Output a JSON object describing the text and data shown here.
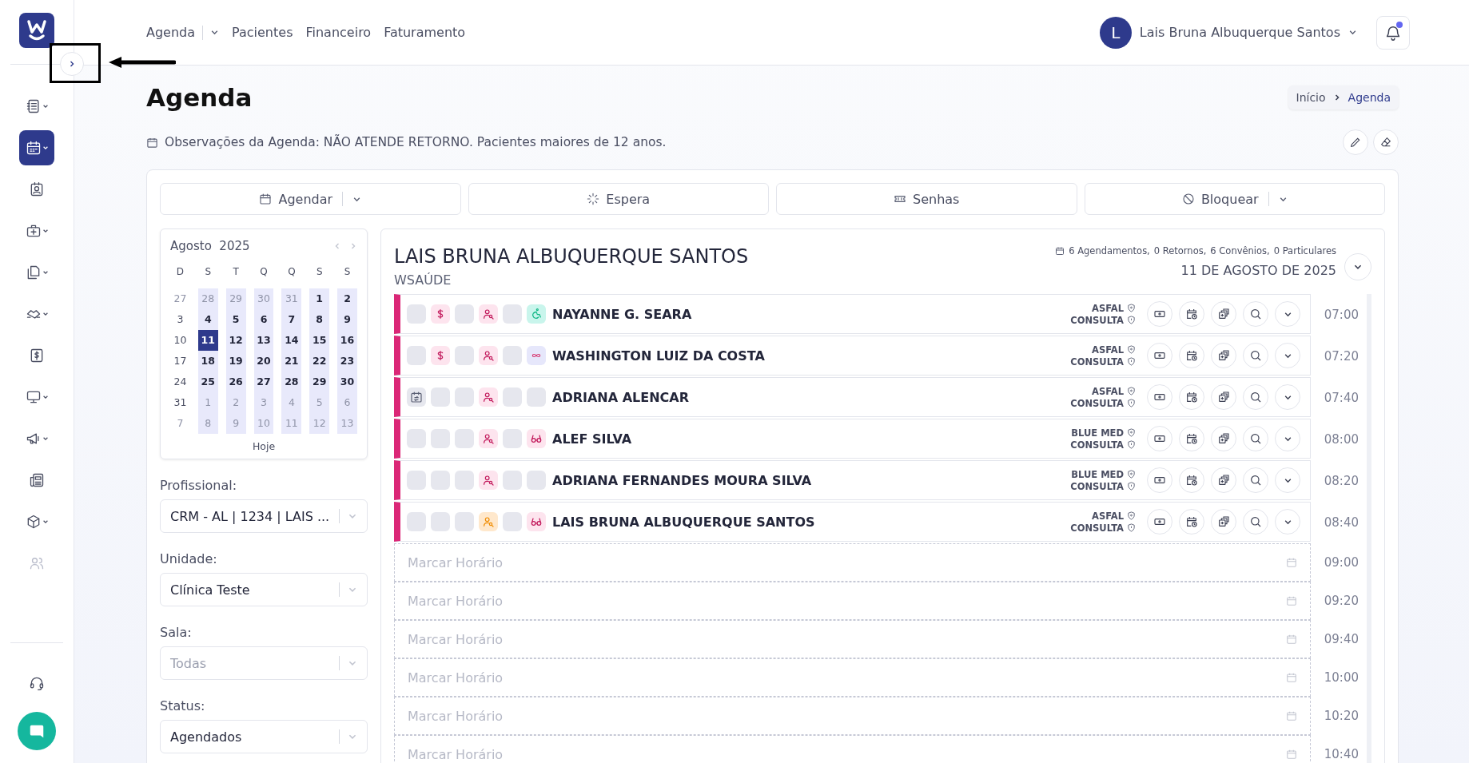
{
  "sidebar": {
    "items": [
      {
        "kind": "list",
        "dropdown": true,
        "selected": false,
        "disabled": false
      },
      {
        "kind": "calendar",
        "dropdown": true,
        "selected": true,
        "disabled": false
      },
      {
        "kind": "contact",
        "dropdown": false,
        "selected": false,
        "disabled": false
      },
      {
        "kind": "medkit",
        "dropdown": true,
        "selected": false,
        "disabled": false
      },
      {
        "kind": "files",
        "dropdown": true,
        "selected": false,
        "disabled": false
      },
      {
        "kind": "handshake",
        "dropdown": true,
        "selected": false,
        "disabled": false
      },
      {
        "kind": "money",
        "dropdown": false,
        "selected": false,
        "disabled": false
      },
      {
        "kind": "monitor",
        "dropdown": true,
        "selected": false,
        "disabled": false
      },
      {
        "kind": "megaphone",
        "dropdown": true,
        "selected": false,
        "disabled": false
      },
      {
        "kind": "news",
        "dropdown": false,
        "selected": false,
        "disabled": false
      },
      {
        "kind": "cube",
        "dropdown": true,
        "selected": false,
        "disabled": false
      },
      {
        "kind": "users",
        "dropdown": false,
        "selected": false,
        "disabled": true
      }
    ]
  },
  "nav": [
    {
      "label": "Agenda",
      "dropdown": true
    },
    {
      "label": "Pacientes",
      "dropdown": false
    },
    {
      "label": "Financeiro",
      "dropdown": false
    },
    {
      "label": "Faturamento",
      "dropdown": false
    }
  ],
  "user": {
    "initial": "L",
    "name": "Lais Bruna Albuquerque Santos",
    "unread": true
  },
  "page_title": "Agenda",
  "breadcrumb": [
    {
      "label": "Início",
      "current": false
    },
    {
      "label": "Agenda",
      "current": true
    }
  ],
  "observation": "Observações da Agenda: NÃO ATENDE RETORNO. Pacientes maiores de 12 anos.",
  "actions": [
    {
      "label": "Agendar",
      "kind": "calendar",
      "dropdown": true
    },
    {
      "label": "Espera",
      "kind": "loader",
      "dropdown": false
    },
    {
      "label": "Senhas",
      "kind": "ticket",
      "dropdown": false
    },
    {
      "label": "Bloquear",
      "kind": "ban",
      "dropdown": true
    }
  ],
  "calendar": {
    "month": "Agosto",
    "year": "2025",
    "weekdays": [
      "D",
      "S",
      "T",
      "Q",
      "Q",
      "S",
      "S"
    ],
    "today_label": "Hoje",
    "weeks": [
      [
        {
          "d": "27",
          "outside": true,
          "open": false,
          "selected": false
        },
        {
          "d": "28",
          "outside": true,
          "open": true,
          "selected": false
        },
        {
          "d": "29",
          "outside": true,
          "open": true,
          "selected": false
        },
        {
          "d": "30",
          "outside": true,
          "open": true,
          "selected": false
        },
        {
          "d": "31",
          "outside": true,
          "open": true,
          "selected": false
        },
        {
          "d": "1",
          "outside": false,
          "open": true,
          "selected": false
        },
        {
          "d": "2",
          "outside": false,
          "open": true,
          "selected": false
        }
      ],
      [
        {
          "d": "3",
          "outside": false,
          "open": false,
          "selected": false
        },
        {
          "d": "4",
          "outside": false,
          "open": true,
          "selected": false
        },
        {
          "d": "5",
          "outside": false,
          "open": true,
          "selected": false
        },
        {
          "d": "6",
          "outside": false,
          "open": true,
          "selected": false
        },
        {
          "d": "7",
          "outside": false,
          "open": true,
          "selected": false
        },
        {
          "d": "8",
          "outside": false,
          "open": true,
          "selected": false
        },
        {
          "d": "9",
          "outside": false,
          "open": true,
          "selected": false
        }
      ],
      [
        {
          "d": "10",
          "outside": false,
          "open": false,
          "selected": false
        },
        {
          "d": "11",
          "outside": false,
          "open": true,
          "selected": true
        },
        {
          "d": "12",
          "outside": false,
          "open": true,
          "selected": false
        },
        {
          "d": "13",
          "outside": false,
          "open": true,
          "selected": false
        },
        {
          "d": "14",
          "outside": false,
          "open": true,
          "selected": false
        },
        {
          "d": "15",
          "outside": false,
          "open": true,
          "selected": false
        },
        {
          "d": "16",
          "outside": false,
          "open": true,
          "selected": false
        }
      ],
      [
        {
          "d": "17",
          "outside": false,
          "open": false,
          "selected": false
        },
        {
          "d": "18",
          "outside": false,
          "open": true,
          "selected": false
        },
        {
          "d": "19",
          "outside": false,
          "open": true,
          "selected": false
        },
        {
          "d": "20",
          "outside": false,
          "open": true,
          "selected": false
        },
        {
          "d": "21",
          "outside": false,
          "open": true,
          "selected": false
        },
        {
          "d": "22",
          "outside": false,
          "open": true,
          "selected": false
        },
        {
          "d": "23",
          "outside": false,
          "open": true,
          "selected": false
        }
      ],
      [
        {
          "d": "24",
          "outside": false,
          "open": false,
          "selected": false
        },
        {
          "d": "25",
          "outside": false,
          "open": true,
          "selected": false
        },
        {
          "d": "26",
          "outside": false,
          "open": true,
          "selected": false
        },
        {
          "d": "27",
          "outside": false,
          "open": true,
          "selected": false
        },
        {
          "d": "28",
          "outside": false,
          "open": true,
          "selected": false
        },
        {
          "d": "29",
          "outside": false,
          "open": true,
          "selected": false
        },
        {
          "d": "30",
          "outside": false,
          "open": true,
          "selected": false
        }
      ],
      [
        {
          "d": "31",
          "outside": false,
          "open": false,
          "selected": false
        },
        {
          "d": "1",
          "outside": true,
          "open": true,
          "selected": false
        },
        {
          "d": "2",
          "outside": true,
          "open": true,
          "selected": false
        },
        {
          "d": "3",
          "outside": true,
          "open": true,
          "selected": false
        },
        {
          "d": "4",
          "outside": true,
          "open": true,
          "selected": false
        },
        {
          "d": "5",
          "outside": true,
          "open": true,
          "selected": false
        },
        {
          "d": "6",
          "outside": true,
          "open": true,
          "selected": false
        }
      ],
      [
        {
          "d": "7",
          "outside": true,
          "open": false,
          "selected": false
        },
        {
          "d": "8",
          "outside": true,
          "open": true,
          "selected": false
        },
        {
          "d": "9",
          "outside": true,
          "open": true,
          "selected": false
        },
        {
          "d": "10",
          "outside": true,
          "open": true,
          "selected": false
        },
        {
          "d": "11",
          "outside": true,
          "open": true,
          "selected": false
        },
        {
          "d": "12",
          "outside": true,
          "open": true,
          "selected": false
        },
        {
          "d": "13",
          "outside": true,
          "open": true,
          "selected": false
        }
      ]
    ]
  },
  "filters": [
    {
      "label": "Profissional:",
      "value": "CRM - AL | 1234 | LAIS ..."
    },
    {
      "label": "Unidade:",
      "value": "Clínica Teste"
    },
    {
      "label": "Sala:",
      "placeholder": "Todas"
    },
    {
      "label": "Status:",
      "value": "Agendados"
    }
  ],
  "schedule": {
    "professional": "LAIS BRUNA ALBUQUERQUE SANTOS",
    "unit": "WSAÚDE",
    "stats": [
      "6 Agendamentos,",
      "0 Retornos,",
      "6 Convênios,",
      "0 Particulares"
    ],
    "date": "11 DE AGOSTO DE 2025",
    "appointments": [
      {
        "name": "NAYANNE G. SEARA",
        "plan": "ASFAL",
        "type": "CONSULTA",
        "time": "07:00",
        "badges": [
          {
            "kind": "blank"
          },
          {
            "kind": "money"
          },
          {
            "kind": "blank"
          },
          {
            "kind": "patient"
          },
          {
            "kind": "blank"
          },
          {
            "kind": "accessibility"
          }
        ]
      },
      {
        "name": "WASHINGTON LUIZ DA COSTA",
        "plan": "ASFAL",
        "type": "CONSULTA",
        "time": "07:20",
        "badges": [
          {
            "kind": "blank"
          },
          {
            "kind": "money"
          },
          {
            "kind": "blank"
          },
          {
            "kind": "patient"
          },
          {
            "kind": "blank"
          },
          {
            "kind": "infinity"
          }
        ]
      },
      {
        "name": "ADRIANA ALENCAR",
        "plan": "ASFAL",
        "type": "CONSULTA",
        "time": "07:40",
        "badges": [
          {
            "kind": "reschedule"
          },
          {
            "kind": "blank"
          },
          {
            "kind": "blank"
          },
          {
            "kind": "patient"
          },
          {
            "kind": "blank"
          },
          {
            "kind": "blank"
          }
        ]
      },
      {
        "name": "ALEF SILVA",
        "plan": "BLUE MED",
        "type": "CONSULTA",
        "time": "08:00",
        "badges": [
          {
            "kind": "blank"
          },
          {
            "kind": "blank"
          },
          {
            "kind": "blank"
          },
          {
            "kind": "patient"
          },
          {
            "kind": "blank"
          },
          {
            "kind": "glasses"
          }
        ]
      },
      {
        "name": "ADRIANA FERNANDES MOURA SILVA",
        "plan": "BLUE MED",
        "type": "CONSULTA",
        "time": "08:20",
        "badges": [
          {
            "kind": "blank"
          },
          {
            "kind": "blank"
          },
          {
            "kind": "blank"
          },
          {
            "kind": "patient"
          },
          {
            "kind": "blank"
          },
          {
            "kind": "blank"
          }
        ]
      },
      {
        "name": "LAIS BRUNA ALBUQUERQUE SANTOS",
        "plan": "ASFAL",
        "type": "CONSULTA",
        "time": "08:40",
        "badges": [
          {
            "kind": "blank"
          },
          {
            "kind": "blank"
          },
          {
            "kind": "blank"
          },
          {
            "kind": "patient-pending"
          },
          {
            "kind": "blank"
          },
          {
            "kind": "glasses"
          }
        ]
      }
    ],
    "free_slots": [
      {
        "placeholder": "Marcar Horário",
        "time": "09:00"
      },
      {
        "placeholder": "Marcar Horário",
        "time": "09:20"
      },
      {
        "placeholder": "Marcar Horário",
        "time": "09:40"
      },
      {
        "placeholder": "Marcar Horário",
        "time": "10:00"
      },
      {
        "placeholder": "Marcar Horário",
        "time": "10:20"
      },
      {
        "placeholder": "Marcar Horário",
        "time": "10:40"
      }
    ]
  }
}
